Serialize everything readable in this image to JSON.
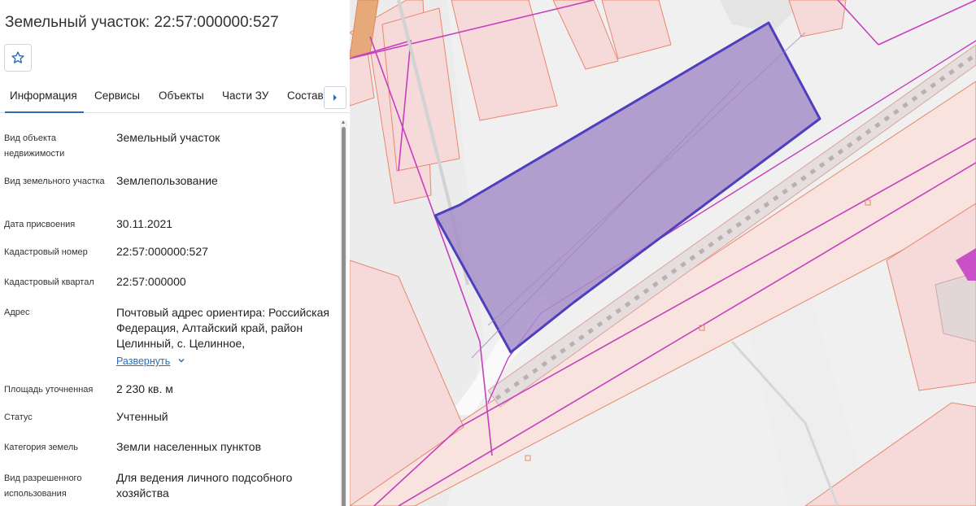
{
  "header": {
    "title": "Земельный участок: 22:57:000000:527"
  },
  "favorite": {
    "icon": "star-outline-icon"
  },
  "tabs": [
    {
      "label": "Информация",
      "active": true
    },
    {
      "label": "Сервисы"
    },
    {
      "label": "Объекты"
    },
    {
      "label": "Части ЗУ"
    },
    {
      "label": "Состав"
    }
  ],
  "tabs_next_icon": "caret-right-icon",
  "info": [
    {
      "label": "Вид объекта недвижимости",
      "value": "Земельный участок"
    },
    {
      "label": "Вид земельного участка",
      "value": "Землепользование"
    },
    {
      "label": "Дата присвоения",
      "value": "30.11.2021"
    },
    {
      "label": "Кадастровый номер",
      "value": "22:57:000000:527"
    },
    {
      "label": "Кадастровый квартал",
      "value": "22:57:000000"
    },
    {
      "label": "Адрес",
      "value": "Почтовый адрес ориентира: Российская Федерация, Алтайский край, район Целинный, с. Целинное,"
    },
    {
      "label": "Площадь уточненная",
      "value": "2 230 кв. м"
    },
    {
      "label": "Статус",
      "value": "Учтенный"
    },
    {
      "label": "Категория земель",
      "value": "Земли населенных пунктов"
    },
    {
      "label": "Вид разрешенного использования",
      "value": "Для ведения личного подсобного хозяйства"
    }
  ],
  "address_expand_label": "Развернуть",
  "colors": {
    "accent": "#2d6db5",
    "parcel_fill": "#a78fc8",
    "parcel_stroke": "#4f3fbf",
    "boundary_magenta": "#c73fbf",
    "building_fill": "#f6dada",
    "building_stroke": "#e9866e",
    "road_fill": "#f8e2dc"
  }
}
